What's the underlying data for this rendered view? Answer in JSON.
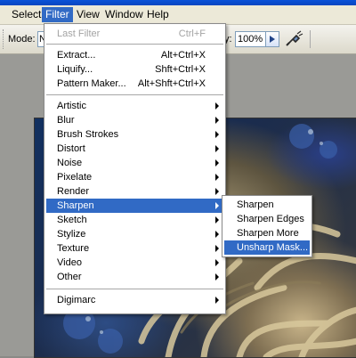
{
  "menubar": {
    "items": [
      {
        "label": "Select"
      },
      {
        "label": "Filter"
      },
      {
        "label": "View"
      },
      {
        "label": "Window"
      },
      {
        "label": "Help"
      }
    ],
    "active": "Filter"
  },
  "options": {
    "mode_label": "Mode:",
    "mode_value": "N",
    "opacity_label": "y:",
    "opacity_value": "100%"
  },
  "filter_menu": {
    "top_items": [
      {
        "label": "Last Filter",
        "shortcut": "Ctrl+F",
        "disabled": true
      }
    ],
    "special_items": [
      {
        "label": "Extract...",
        "shortcut": "Alt+Ctrl+X"
      },
      {
        "label": "Liquify...",
        "shortcut": "Shft+Ctrl+X"
      },
      {
        "label": "Pattern Maker...",
        "shortcut": "Alt+Shft+Ctrl+X"
      }
    ],
    "category_items": [
      {
        "label": "Artistic"
      },
      {
        "label": "Blur"
      },
      {
        "label": "Brush Strokes"
      },
      {
        "label": "Distort"
      },
      {
        "label": "Noise"
      },
      {
        "label": "Pixelate"
      },
      {
        "label": "Render"
      },
      {
        "label": "Sharpen",
        "active": true
      },
      {
        "label": "Sketch"
      },
      {
        "label": "Stylize"
      },
      {
        "label": "Texture"
      },
      {
        "label": "Video"
      },
      {
        "label": "Other"
      }
    ],
    "plugin_items": [
      {
        "label": "Digimarc"
      }
    ]
  },
  "sharpen_submenu": {
    "items": [
      {
        "label": "Sharpen"
      },
      {
        "label": "Sharpen Edges"
      },
      {
        "label": "Sharpen More"
      },
      {
        "label": "Unsharp Mask...",
        "active": true
      }
    ]
  },
  "colors": {
    "highlight": "#316ac5",
    "menubar_bg": "#ece9d8",
    "title_blue": "#0a52d8"
  }
}
